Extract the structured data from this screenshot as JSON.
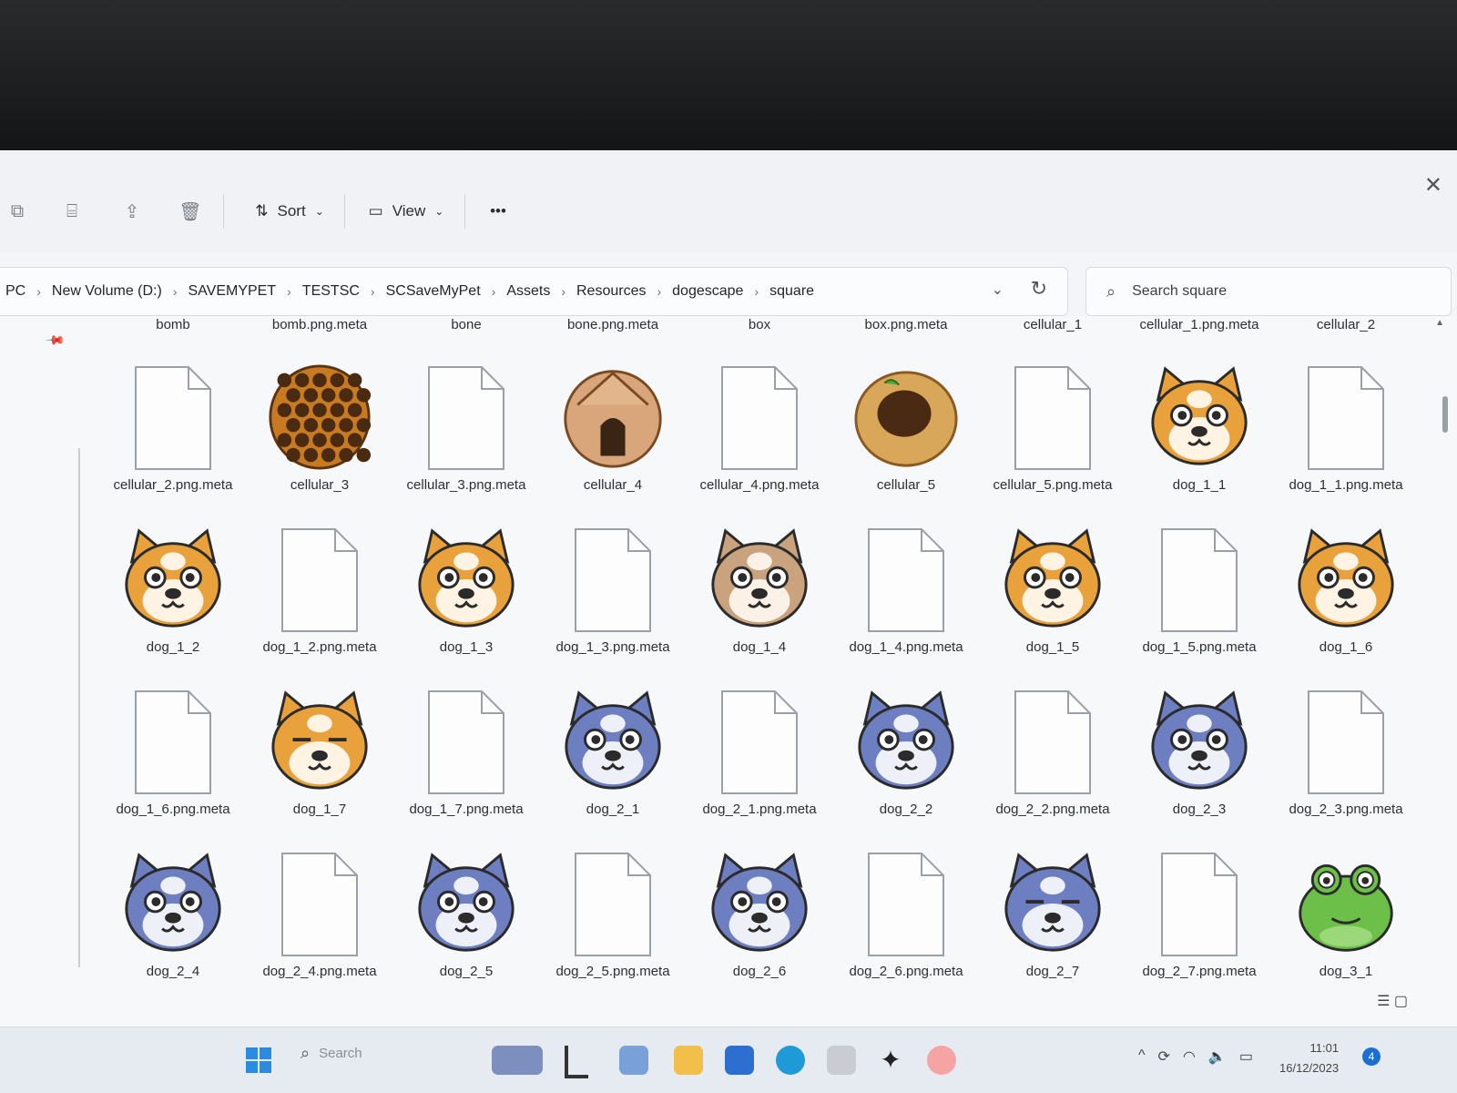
{
  "toolbar": {
    "sort_label": "Sort",
    "view_label": "View",
    "more_label": "•••"
  },
  "address": {
    "crumbs": [
      "PC",
      "New Volume (D:)",
      "SAVEMYPET",
      "TESTSC",
      "SCSaveMyPet",
      "Assets",
      "Resources",
      "dogescape",
      "square"
    ],
    "separator": "›"
  },
  "search": {
    "placeholder": "Search square"
  },
  "top_labels": [
    "bomb",
    "bomb.png.meta",
    "bone",
    "bone.png.meta",
    "box",
    "box.png.meta",
    "cellular_1",
    "cellular_1.png.meta",
    "cellular_2"
  ],
  "items": [
    {
      "name": "cellular_2.png.meta",
      "kind": "file"
    },
    {
      "name": "cellular_3",
      "kind": "honeycomb"
    },
    {
      "name": "cellular_3.png.meta",
      "kind": "file"
    },
    {
      "name": "cellular_4",
      "kind": "doghouse"
    },
    {
      "name": "cellular_4.png.meta",
      "kind": "file"
    },
    {
      "name": "cellular_5",
      "kind": "nest"
    },
    {
      "name": "cellular_5.png.meta",
      "kind": "file"
    },
    {
      "name": "dog_1_1",
      "kind": "dog-orange"
    },
    {
      "name": "dog_1_1.png.meta",
      "kind": "file"
    },
    {
      "name": "dog_1_2",
      "kind": "dog-orange"
    },
    {
      "name": "dog_1_2.png.meta",
      "kind": "file"
    },
    {
      "name": "dog_1_3",
      "kind": "dog-orange"
    },
    {
      "name": "dog_1_3.png.meta",
      "kind": "file"
    },
    {
      "name": "dog_1_4",
      "kind": "dog-tan"
    },
    {
      "name": "dog_1_4.png.meta",
      "kind": "file"
    },
    {
      "name": "dog_1_5",
      "kind": "dog-orange"
    },
    {
      "name": "dog_1_5.png.meta",
      "kind": "file"
    },
    {
      "name": "dog_1_6",
      "kind": "dog-orange"
    },
    {
      "name": "dog_1_6.png.meta",
      "kind": "file"
    },
    {
      "name": "dog_1_7",
      "kind": "dog-orange-sleepy"
    },
    {
      "name": "dog_1_7.png.meta",
      "kind": "file"
    },
    {
      "name": "dog_2_1",
      "kind": "dog-blue"
    },
    {
      "name": "dog_2_1.png.meta",
      "kind": "file"
    },
    {
      "name": "dog_2_2",
      "kind": "dog-blue"
    },
    {
      "name": "dog_2_2.png.meta",
      "kind": "file"
    },
    {
      "name": "dog_2_3",
      "kind": "dog-blue"
    },
    {
      "name": "dog_2_3.png.meta",
      "kind": "file"
    },
    {
      "name": "dog_2_4",
      "kind": "dog-blue"
    },
    {
      "name": "dog_2_4.png.meta",
      "kind": "file"
    },
    {
      "name": "dog_2_5",
      "kind": "dog-blue"
    },
    {
      "name": "dog_2_5.png.meta",
      "kind": "file"
    },
    {
      "name": "dog_2_6",
      "kind": "dog-blue"
    },
    {
      "name": "dog_2_6.png.meta",
      "kind": "file"
    },
    {
      "name": "dog_2_7",
      "kind": "dog-blue-sleepy"
    },
    {
      "name": "dog_2_7.png.meta",
      "kind": "file"
    },
    {
      "name": "dog_3_1",
      "kind": "frog-green"
    }
  ],
  "taskbar": {
    "search_placeholder": "Search",
    "time": "11:01",
    "date": "16/12/2023",
    "notification_count": "4"
  },
  "colors": {
    "accent": "#1a6fd0",
    "dog_orange": "#e9a23b",
    "dog_blue": "#6d7fc0",
    "frog_green": "#6cc04a"
  }
}
